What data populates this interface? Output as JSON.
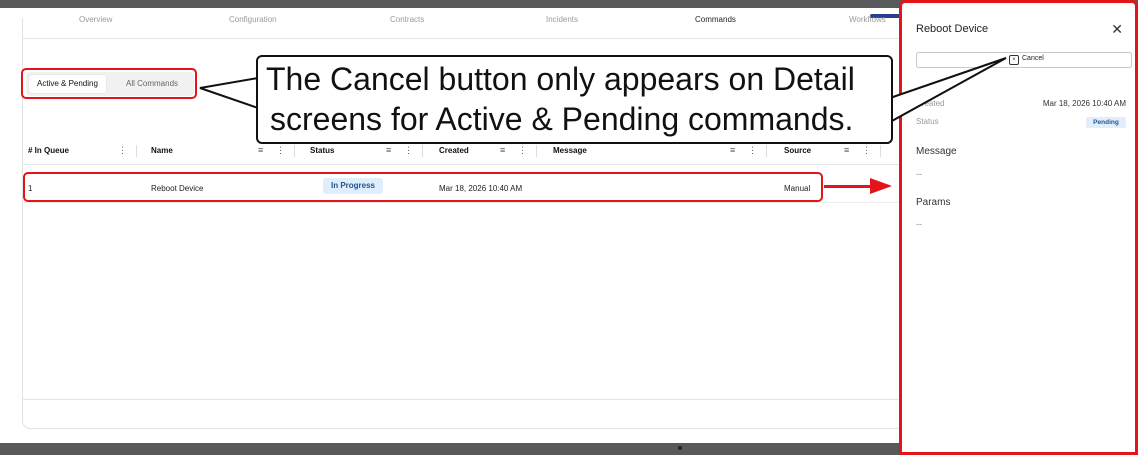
{
  "tabs": [
    "Overview",
    "Configuration",
    "Contracts",
    "Incidents",
    "Commands",
    "Workflows"
  ],
  "active_tab": "Commands",
  "filter_toggle": {
    "active": "Active & Pending",
    "inactive": "All Commands"
  },
  "table": {
    "headers": [
      "# In Queue",
      "Name",
      "Status",
      "Created",
      "Message",
      "Source"
    ],
    "rows": [
      {
        "queue": "1",
        "name": "Reboot Device",
        "status": "In Progress",
        "created": "Mar 18, 2026 10:40 AM",
        "message": "",
        "source": "Manual"
      }
    ]
  },
  "drawer": {
    "title": "Reboot Device",
    "close_glyph": "✕",
    "cancel_label": "Cancel",
    "created_label": "Created",
    "created_value": "Mar 18, 2026 10:40 AM",
    "status_label": "Status",
    "status_value": "Pending",
    "message_title": "Message",
    "message_value": "--",
    "params_title": "Params",
    "params_value": "--"
  },
  "callout": {
    "line1": "The Cancel button only appears on Detail",
    "line2": "screens for Active & Pending commands."
  },
  "colors": {
    "highlight": "#e3151a",
    "badge_bg": "#deeefc",
    "badge_text": "#21558c",
    "chrome": "#58595b"
  },
  "icons": {
    "filter": "filter-icon",
    "column_menu": "kebab-icon",
    "close": "close-icon",
    "cancel": "cancel-square-icon"
  }
}
